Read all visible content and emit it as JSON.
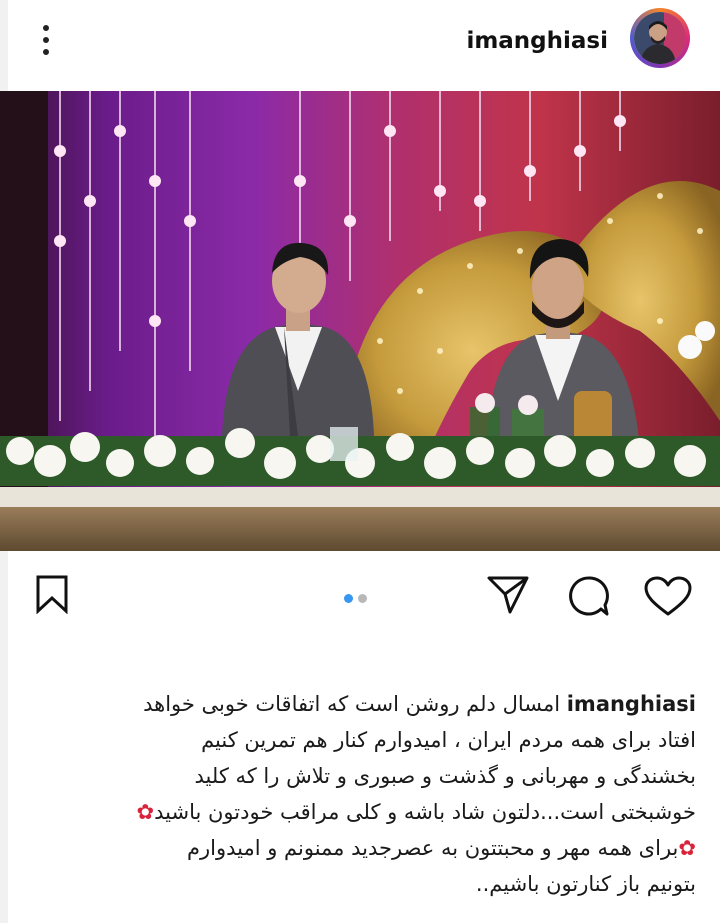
{
  "post": {
    "username": "imanghiasi",
    "caption": {
      "username": "imanghiasi",
      "line1": "امسال دلم روشن است که اتفاقات خوبی خواهد",
      "line2": "افتاد برای همه مردم ایران ، امیدوارم کنار هم تمرین کنیم",
      "line3": "بخشندگی و مهربانی و گذشت و صبوری و تلاش را که کلید",
      "line4": "خوشبختی است...دلتون شاد باشه و کلی مراقب خودتون باشید",
      "line5": "برای همه مهر و محبتتون به عصرجدید ممنونم و امیدوارم",
      "line6": "بتونیم باز کنارتون باشیم.."
    },
    "carousel": {
      "total": 2,
      "current": 1
    }
  },
  "icons": {
    "more": "more-vertical-icon",
    "save": "bookmark-icon",
    "share": "send-icon",
    "comment": "comment-icon",
    "like": "heart-icon",
    "rose": "rose-emoji"
  },
  "colors": {
    "active_dot": "#3897f0",
    "inactive_dot": "#b8b8b8",
    "rose": "#d9233a"
  }
}
